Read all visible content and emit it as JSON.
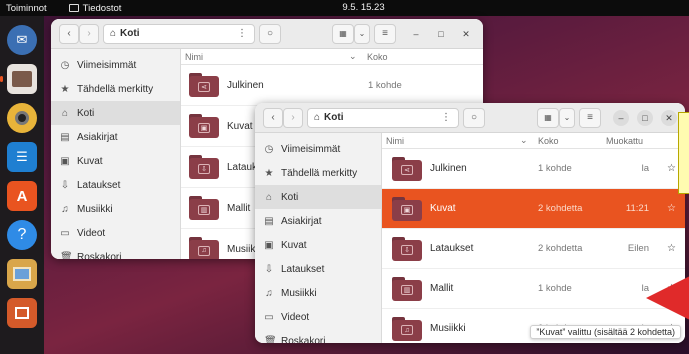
{
  "topbar": {
    "activities": "Toiminnot",
    "app_name": "Tiedostot",
    "clock": "9.5. 15.23"
  },
  "dock": {
    "items": [
      {
        "icon": "thunderbird-icon",
        "color": "#3b6fb3"
      },
      {
        "icon": "files-icon",
        "color": "#e8e3de"
      },
      {
        "icon": "rhythmbox-icon",
        "color": "#e8b43a"
      },
      {
        "icon": "writer-icon",
        "color": "#1f7fd1"
      },
      {
        "icon": "app-center-icon",
        "color": "#e95420"
      },
      {
        "icon": "help-icon",
        "color": "#2f8be6"
      },
      {
        "icon": "image-viewer-icon",
        "color": "#d9a64a"
      },
      {
        "icon": "impress-icon",
        "color": "#d45a2a"
      }
    ]
  },
  "back_window": {
    "location": "Koti",
    "columns": {
      "name": "Nimi",
      "size": "Koko"
    },
    "sidebar": [
      {
        "label": "Viimeisimmät",
        "icon": "clock-icon"
      },
      {
        "label": "Tähdellä merkitty",
        "icon": "star-icon"
      },
      {
        "label": "Koti",
        "icon": "home-icon",
        "selected": true
      },
      {
        "label": "Asiakirjat",
        "icon": "document-icon"
      },
      {
        "label": "Kuvat",
        "icon": "image-icon"
      },
      {
        "label": "Lataukset",
        "icon": "download-icon"
      },
      {
        "label": "Musiikki",
        "icon": "music-icon"
      },
      {
        "label": "Videot",
        "icon": "video-icon"
      },
      {
        "label": "Roskakori",
        "icon": "trash-icon"
      }
    ],
    "files": [
      {
        "name": "Julkinen",
        "size": "1 kohde",
        "emblem": "share"
      },
      {
        "name": "Kuvat",
        "size": "",
        "emblem": "image"
      },
      {
        "name": "Latauk",
        "size": "",
        "emblem": "download"
      },
      {
        "name": "Mallit",
        "size": "",
        "emblem": "template"
      },
      {
        "name": "Musiik",
        "size": "",
        "emblem": "music"
      }
    ]
  },
  "front_window": {
    "location": "Koti",
    "columns": {
      "name": "Nimi",
      "size": "Koko",
      "modified": "Muokattu"
    },
    "sidebar": [
      {
        "label": "Viimeisimmät",
        "icon": "clock-icon"
      },
      {
        "label": "Tähdellä merkitty",
        "icon": "star-icon"
      },
      {
        "label": "Koti",
        "icon": "home-icon",
        "selected": true
      },
      {
        "label": "Asiakirjat",
        "icon": "document-icon"
      },
      {
        "label": "Kuvat",
        "icon": "image-icon"
      },
      {
        "label": "Lataukset",
        "icon": "download-icon"
      },
      {
        "label": "Musiikki",
        "icon": "music-icon"
      },
      {
        "label": "Videot",
        "icon": "video-icon"
      },
      {
        "label": "Roskakori",
        "icon": "trash-icon"
      }
    ],
    "files": [
      {
        "name": "Julkinen",
        "size": "1 kohde",
        "modified": "la",
        "emblem": "share",
        "selected": false
      },
      {
        "name": "Kuvat",
        "size": "2 kohdetta",
        "modified": "11:21",
        "emblem": "image",
        "selected": true
      },
      {
        "name": "Lataukset",
        "size": "2 kohdetta",
        "modified": "Eilen",
        "emblem": "download",
        "selected": false
      },
      {
        "name": "Mallit",
        "size": "1 kohde",
        "modified": "la",
        "emblem": "template",
        "selected": false
      },
      {
        "name": "Musiikki",
        "size": "0 kohdetta",
        "modified": "la",
        "emblem": "music",
        "selected": false
      }
    ],
    "status": "”Kuvat” valittu (sisältää 2 kohdetta)"
  },
  "colors": {
    "accent": "#e95420",
    "folder": "#8b3e48",
    "annotation_arrow": "#e02a2a",
    "tooltip_bg": "#fffbb0"
  }
}
